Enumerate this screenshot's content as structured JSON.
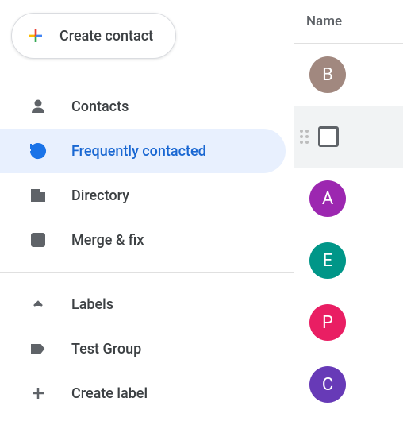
{
  "create": {
    "label": "Create contact"
  },
  "sidebar": {
    "items": [
      {
        "key": "contacts",
        "label": "Contacts",
        "active": false
      },
      {
        "key": "frequently",
        "label": "Frequently contacted",
        "active": true
      },
      {
        "key": "directory",
        "label": "Directory",
        "active": false
      },
      {
        "key": "merge-fix",
        "label": "Merge & fix",
        "active": false
      }
    ],
    "labelsHeader": "Labels",
    "groups": [
      {
        "key": "test-group",
        "label": "Test Group"
      }
    ],
    "createLabel": "Create label"
  },
  "main": {
    "header": "Name",
    "contacts": [
      {
        "initial": "B",
        "color": "#a1887f",
        "selected": false
      },
      {
        "initial": "",
        "color": "",
        "selected": true
      },
      {
        "initial": "A",
        "color": "#9c27b0",
        "selected": false
      },
      {
        "initial": "E",
        "color": "#009688",
        "selected": false
      },
      {
        "initial": "P",
        "color": "#e91e63",
        "selected": false
      },
      {
        "initial": "C",
        "color": "#673ab7",
        "selected": false
      }
    ]
  }
}
